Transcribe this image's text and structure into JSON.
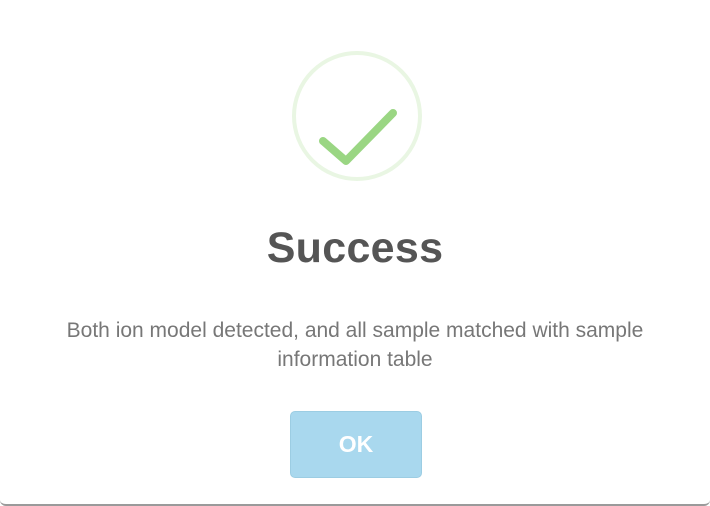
{
  "dialog": {
    "icon": "checkmark-circle-icon",
    "title": "Success",
    "message": "Both ion model detected, and all sample matched with sample information table",
    "ok_label": "OK"
  },
  "colors": {
    "check_green": "#9ad683",
    "circle_ring": "#e9f6e3",
    "title_text": "#555555",
    "message_text": "#777777",
    "button_bg": "#a9d8ee",
    "button_text": "#ffffff"
  }
}
